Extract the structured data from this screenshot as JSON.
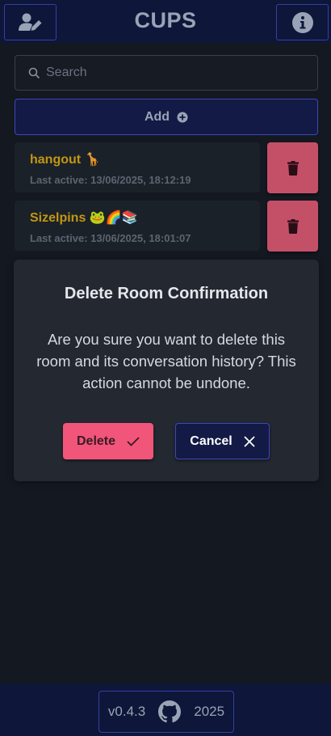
{
  "header": {
    "title": "CUPS",
    "left_icon": "user-edit-icon",
    "right_icon": "info-icon"
  },
  "search": {
    "placeholder": "Search",
    "value": ""
  },
  "add_button": {
    "label": "Add",
    "icon": "plus-circle-icon"
  },
  "rooms": [
    {
      "name": "hangout 🦒",
      "last_active": "Last active: 13/06/2025, 18:12:19"
    },
    {
      "name": "Sizelpins 🐸🌈📚",
      "last_active": "Last active: 13/06/2025, 18:01:07"
    }
  ],
  "modal": {
    "title": "Delete Room Confirmation",
    "message": "Are you sure you want to delete this room and its conversation history? This action cannot be undone.",
    "delete_label": "Delete",
    "cancel_label": "Cancel"
  },
  "footer": {
    "version": "v0.4.3",
    "year": "2025",
    "icon": "github-icon"
  },
  "colors": {
    "header_bg": "#0e1639",
    "accent": "#3c48b8",
    "room_name": "#c29712",
    "danger": "#f2557a",
    "trash": "#c45068"
  }
}
